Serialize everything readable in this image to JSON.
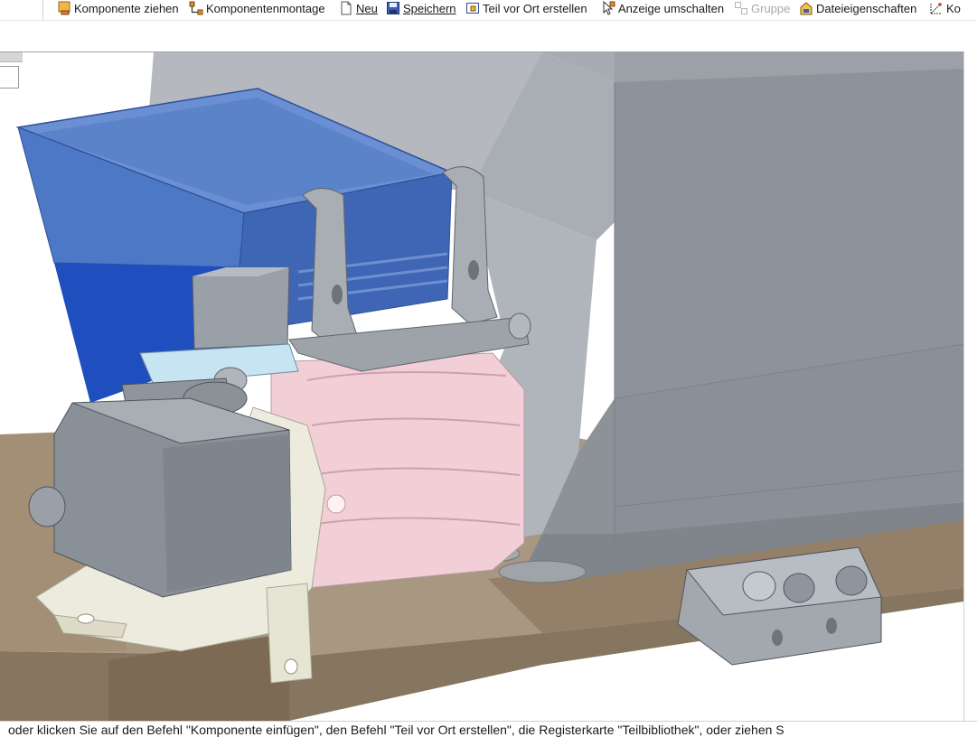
{
  "toolbar": {
    "items": [
      {
        "label": "Komponente ziehen",
        "icon": "drag-component-icon",
        "enabled": true
      },
      {
        "label": "Komponentenmontage",
        "icon": "assembly-icon",
        "enabled": true
      },
      {
        "label": "Neu",
        "icon": "new-document-icon",
        "enabled": true
      },
      {
        "label": "Speichern",
        "icon": "save-icon",
        "enabled": true
      },
      {
        "label": "Teil vor Ort erstellen",
        "icon": "create-in-place-icon",
        "enabled": true
      },
      {
        "label": "Anzeige umschalten",
        "icon": "toggle-display-icon",
        "enabled": true
      },
      {
        "label": "Gruppe",
        "icon": "group-icon",
        "enabled": false
      },
      {
        "label": "Dateieigenschaften",
        "icon": "file-properties-icon",
        "enabled": true
      },
      {
        "label": "Ko",
        "icon": "coordinate-icon",
        "enabled": true
      }
    ]
  },
  "status": {
    "prompt": "oder klicken Sie auf den Befehl \"Komponente einfügen\", den Befehl \"Teil vor Ort erstellen\", die Registerkarte \"Teilbibliothek\", oder ziehen S"
  },
  "colors": {
    "hopper_blue": "#4f7cc6",
    "housing_gray": "#9aa0a8",
    "rotor_pink": "#f0c8d0",
    "base_brown": "#8c7a66",
    "bracket_cream": "#ecebdc"
  }
}
